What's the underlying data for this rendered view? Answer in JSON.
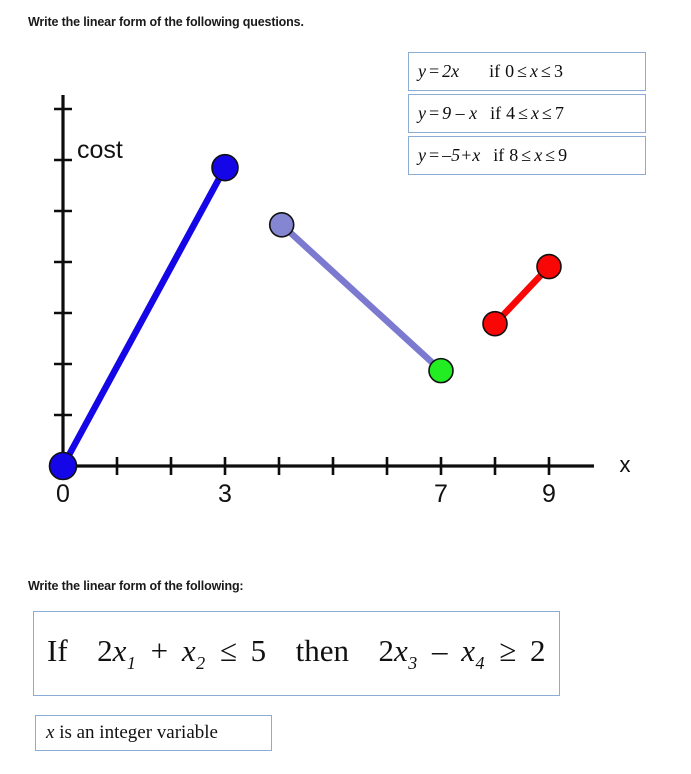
{
  "headings": {
    "first": "Write the linear form of the following questions.",
    "second": "Write the linear form of the following:"
  },
  "equation_boxes": [
    {
      "lhs": "y",
      "eq": "=",
      "rhs": "2x",
      "cond_if": "if",
      "cond_lo": "0",
      "rel1": "≤",
      "cond_var": "x",
      "rel2": "≤",
      "cond_hi": "3",
      "full": "y = 2x   if 0 ≤ x ≤ 3"
    },
    {
      "lhs": "y",
      "eq": "=",
      "rhs": "9 – x",
      "cond_if": "if",
      "cond_lo": "4",
      "rel1": "≤",
      "cond_var": "x",
      "rel2": "≤",
      "cond_hi": "7",
      "full": "y = 9 – x  if 4 ≤ x ≤ 7"
    },
    {
      "lhs": "y",
      "eq": "=",
      "rhs": "–5+x",
      "cond_if": "if",
      "cond_lo": "8",
      "rel1": "≤",
      "cond_var": "x",
      "rel2": "≤",
      "cond_hi": "9",
      "full": "y = –5+x  if 8 ≤ x ≤ 9"
    }
  ],
  "implication_box": {
    "if_word": "If",
    "lhs_c1": "2",
    "lhs_v1": "x",
    "lhs_i1": "1",
    "plus": "+",
    "lhs_v2": "x",
    "lhs_i2": "2",
    "rel_lhs": "≤",
    "rhs_lhs_value": "5",
    "then_word": "then",
    "rhs_c1": "2",
    "rhs_v1": "x",
    "rhs_i1": "3",
    "minus": "–",
    "rhs_v2": "x",
    "rhs_i2": "4",
    "rel_rhs": "≥",
    "rhs_rhs_value": "2",
    "full": "If  2x1 + x2 ≤ 5   then  2x3 – x4 ≥ 2"
  },
  "integer_box": {
    "var": "x",
    "text": " is an integer variable",
    "full": "x is an integer variable"
  },
  "chart_data": {
    "type": "line",
    "title": "",
    "xlabel": "x",
    "ylabel": "cost",
    "xlim": [
      0,
      11
    ],
    "ylim": [
      0,
      7.4
    ],
    "grid": false,
    "legend": "none",
    "x_ticks": [
      0,
      1,
      2,
      3,
      4,
      5,
      6,
      7,
      8,
      9
    ],
    "x_tick_labels": [
      "0",
      "",
      "",
      "3",
      "",
      "",
      "",
      "7",
      "",
      "9"
    ],
    "y_ticks": [
      1,
      2,
      3,
      4,
      5,
      6,
      7
    ],
    "y_tick_labels": [
      "",
      "",
      "",
      "",
      "",
      "",
      ""
    ],
    "colors": {
      "segment_1": "#1506e8",
      "segment_2": "#7b7ad0",
      "segment_3": "#f90606",
      "marker_start": "#1506e8",
      "marker_green": "#22ec22",
      "axis": "#0d0d0d"
    },
    "series": [
      {
        "name": "y = 2x (0 ≤ x ≤ 3)",
        "color": "#1506e8",
        "points": [
          {
            "x": 0,
            "y": 0,
            "marker_color": "#1506e8"
          },
          {
            "x": 3,
            "y": 5.85,
            "marker_color": "#1506e8"
          }
        ]
      },
      {
        "name": "y = 9 - x (4 ≤ x ≤ 7)",
        "color": "#7b7ad0",
        "points": [
          {
            "x": 4.05,
            "y": 4.73,
            "marker_color": "#8486d2"
          },
          {
            "x": 7.0,
            "y": 1.87,
            "marker_color": "#22ec22"
          }
        ]
      },
      {
        "name": "y = -5 + x (8 ≤ x ≤ 9)",
        "color": "#f90606",
        "points": [
          {
            "x": 8.0,
            "y": 2.79,
            "marker_color": "#f90606"
          },
          {
            "x": 9.0,
            "y": 3.91,
            "marker_color": "#f90606"
          }
        ]
      }
    ]
  }
}
